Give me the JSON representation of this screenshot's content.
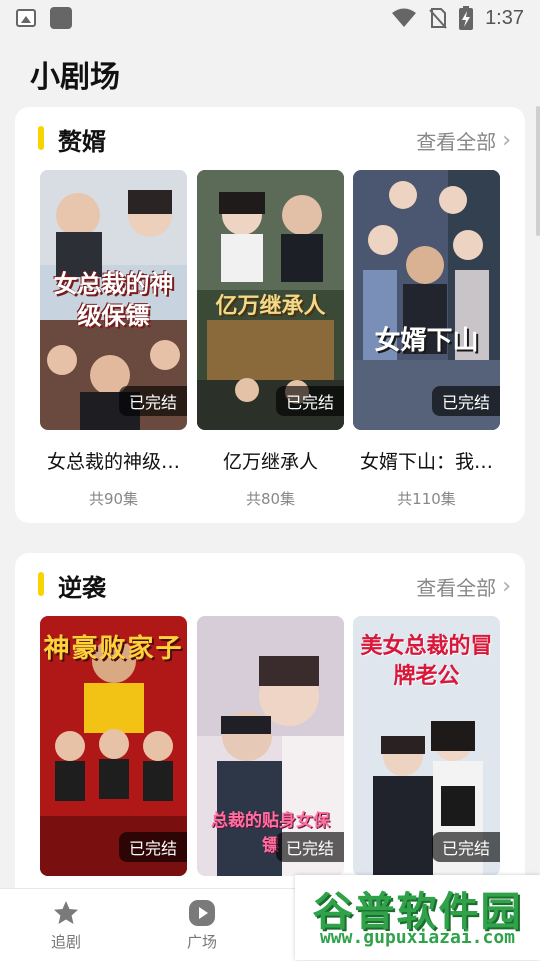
{
  "status": {
    "time": "1:37"
  },
  "page": {
    "title": "小剧场"
  },
  "sections": [
    {
      "title": "赘婿",
      "see_all": "查看全部",
      "dramas": [
        {
          "title": "女总裁的神级…",
          "episodes": "共90集",
          "badge": "已完结",
          "poster_text": "女总裁的神级保镖"
        },
        {
          "title": "亿万继承人",
          "episodes": "共80集",
          "badge": "已完结",
          "poster_text": "亿万继承人"
        },
        {
          "title": "女婿下山：我…",
          "episodes": "共110集",
          "badge": "已完结",
          "poster_text": "女婿下山"
        }
      ]
    },
    {
      "title": "逆袭",
      "see_all": "查看全部",
      "dramas": [
        {
          "badge": "已完结",
          "poster_text": "神豪败家子"
        },
        {
          "badge": "已完结",
          "poster_text": "总裁的贴身女保镖"
        },
        {
          "badge": "已完结",
          "poster_text": "美女总裁的冒牌老公"
        }
      ]
    }
  ],
  "tabs": [
    {
      "label": "追剧",
      "icon": "star-icon"
    },
    {
      "label": "广场",
      "icon": "play-icon"
    }
  ],
  "watermark": {
    "logo": "谷普软件园",
    "url": "www.gupuxiazai.com"
  },
  "colors": {
    "accent": "#f7d400",
    "background": "#f2f2f2",
    "watermark": "#2fa24a"
  }
}
